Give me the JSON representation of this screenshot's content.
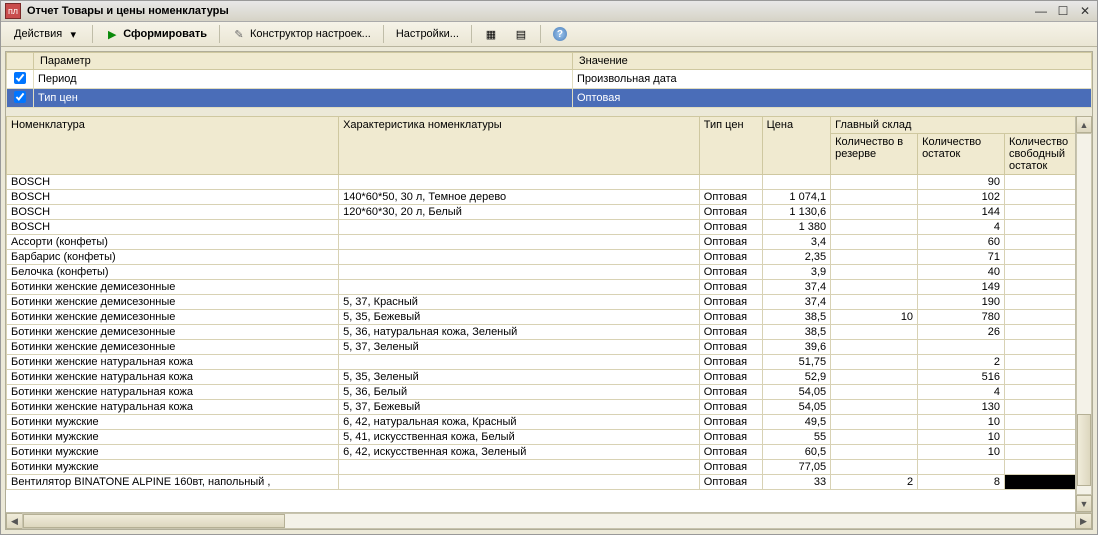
{
  "window": {
    "icon_text": "пл",
    "title": "Отчет  Товары и цены номенклатуры"
  },
  "toolbar": {
    "actions": "Действия",
    "form": "Сформировать",
    "constructor": "Конструктор настроек...",
    "settings": "Настройки..."
  },
  "params": {
    "headers": {
      "param": "Параметр",
      "value": "Значение"
    },
    "rows": [
      {
        "checked": true,
        "name": "Период",
        "value": "Произвольная дата",
        "selected": false
      },
      {
        "checked": true,
        "name": "Тип цен",
        "value": "Оптовая",
        "selected": true
      }
    ]
  },
  "report_headers": {
    "nomen": "Номенклатура",
    "char": "Характеристика номенклатуры",
    "type": "Тип цен",
    "price": "Цена",
    "warehouse": "Главный склад",
    "qty_reserve": "Количество в резерве",
    "qty_remain": "Количество остаток",
    "qty_free": "Количество свободный остаток"
  },
  "rows": [
    {
      "n": "BOSCH",
      "c": "",
      "t": "",
      "p": "",
      "r": "",
      "q": "90"
    },
    {
      "n": "BOSCH",
      "c": "140*60*50, 30 л, Темное дерево",
      "t": "Оптовая",
      "p": "1 074,1",
      "r": "",
      "q": "102"
    },
    {
      "n": "BOSCH",
      "c": "120*60*30, 20 л, Белый",
      "t": "Оптовая",
      "p": "1 130,6",
      "r": "",
      "q": "144"
    },
    {
      "n": "BOSCH",
      "c": "",
      "t": "Оптовая",
      "p": "1 380",
      "r": "",
      "q": "4"
    },
    {
      "n": "Ассорти (конфеты)",
      "c": "",
      "t": "Оптовая",
      "p": "3,4",
      "r": "",
      "q": "60"
    },
    {
      "n": "Барбарис (конфеты)",
      "c": "",
      "t": "Оптовая",
      "p": "2,35",
      "r": "",
      "q": "71"
    },
    {
      "n": "Белочка (конфеты)",
      "c": "",
      "t": "Оптовая",
      "p": "3,9",
      "r": "",
      "q": "40"
    },
    {
      "n": "Ботинки женские демисезонные",
      "c": "",
      "t": "Оптовая",
      "p": "37,4",
      "r": "",
      "q": "149"
    },
    {
      "n": "Ботинки женские демисезонные",
      "c": "5, 37, Красный",
      "t": "Оптовая",
      "p": "37,4",
      "r": "",
      "q": "190"
    },
    {
      "n": "Ботинки женские демисезонные",
      "c": "5, 35, Бежевый",
      "t": "Оптовая",
      "p": "38,5",
      "r": "10",
      "q": "780"
    },
    {
      "n": "Ботинки женские демисезонные",
      "c": "5, 36, натуральная кожа, Зеленый",
      "t": "Оптовая",
      "p": "38,5",
      "r": "",
      "q": "26"
    },
    {
      "n": "Ботинки женские демисезонные",
      "c": "5, 37, Зеленый",
      "t": "Оптовая",
      "p": "39,6",
      "r": "",
      "q": ""
    },
    {
      "n": "Ботинки женские натуральная кожа",
      "c": "",
      "t": "Оптовая",
      "p": "51,75",
      "r": "",
      "q": "2"
    },
    {
      "n": "Ботинки женские натуральная кожа",
      "c": "5, 35, Зеленый",
      "t": "Оптовая",
      "p": "52,9",
      "r": "",
      "q": "516"
    },
    {
      "n": "Ботинки женские натуральная кожа",
      "c": "5, 36, Белый",
      "t": "Оптовая",
      "p": "54,05",
      "r": "",
      "q": "4"
    },
    {
      "n": "Ботинки женские натуральная кожа",
      "c": "5, 37, Бежевый",
      "t": "Оптовая",
      "p": "54,05",
      "r": "",
      "q": "130"
    },
    {
      "n": "Ботинки мужские",
      "c": "6, 42, натуральная кожа, Красный",
      "t": "Оптовая",
      "p": "49,5",
      "r": "",
      "q": "10"
    },
    {
      "n": "Ботинки мужские",
      "c": "5, 41, искусственная кожа, Белый",
      "t": "Оптовая",
      "p": "55",
      "r": "",
      "q": "10"
    },
    {
      "n": "Ботинки мужские",
      "c": "6, 42, искусственная кожа, Зеленый",
      "t": "Оптовая",
      "p": "60,5",
      "r": "",
      "q": "10"
    },
    {
      "n": "Ботинки мужские",
      "c": "",
      "t": "Оптовая",
      "p": "77,05",
      "r": "",
      "q": ""
    },
    {
      "n": "Вентилятор BINATONE ALPINE 160вт, напольный ,",
      "c": "",
      "t": "Оптовая",
      "p": "33",
      "r": "2",
      "q": "8",
      "focused": true
    }
  ]
}
